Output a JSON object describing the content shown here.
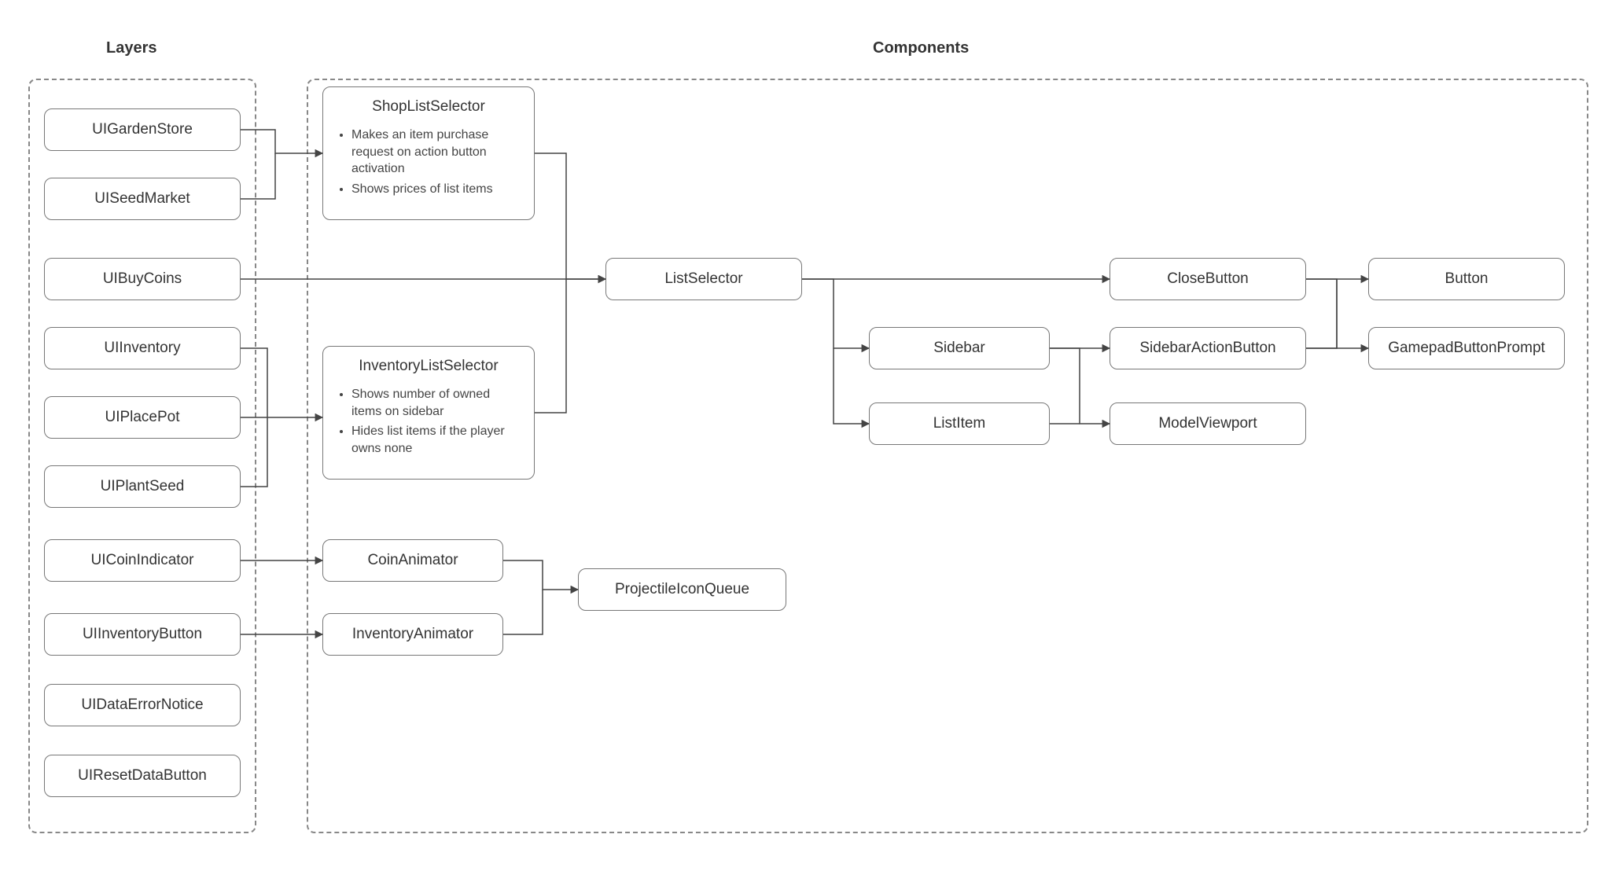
{
  "groups": {
    "layers": {
      "label": "Layers"
    },
    "components": {
      "label": "Components"
    }
  },
  "nodes": {
    "uiGardenStore": {
      "label": "UIGardenStore"
    },
    "uiSeedMarket": {
      "label": "UISeedMarket"
    },
    "uiBuyCoins": {
      "label": "UIBuyCoins"
    },
    "uiInventory": {
      "label": "UIInventory"
    },
    "uiPlacePot": {
      "label": "UIPlacePot"
    },
    "uiPlantSeed": {
      "label": "UIPlantSeed"
    },
    "uiCoinIndicator": {
      "label": "UICoinIndicator"
    },
    "uiInventoryButton": {
      "label": "UIInventoryButton"
    },
    "uiDataErrorNotice": {
      "label": "UIDataErrorNotice"
    },
    "uiResetDataButton": {
      "label": "UIResetDataButton"
    },
    "shopListSelector": {
      "label": "ShopListSelector",
      "bullets": [
        "Makes an item purchase request on action button activation",
        "Shows prices of list items"
      ]
    },
    "inventoryListSelector": {
      "label": "InventoryListSelector",
      "bullets": [
        "Shows number of owned items on sidebar",
        "Hides list items if the player owns none"
      ]
    },
    "coinAnimator": {
      "label": "CoinAnimator"
    },
    "inventoryAnimator": {
      "label": "InventoryAnimator"
    },
    "projectileIconQueue": {
      "label": "ProjectileIconQueue"
    },
    "listSelector": {
      "label": "ListSelector"
    },
    "sidebar": {
      "label": "Sidebar"
    },
    "listItem": {
      "label": "ListItem"
    },
    "closeButton": {
      "label": "CloseButton"
    },
    "sidebarActionButton": {
      "label": "SidebarActionButton"
    },
    "modelViewport": {
      "label": "ModelViewport"
    },
    "button": {
      "label": "Button"
    },
    "gamepadButtonPrompt": {
      "label": "GamepadButtonPrompt"
    }
  },
  "edges": [
    {
      "from": "uiGardenStore",
      "to": "shopListSelector"
    },
    {
      "from": "uiSeedMarket",
      "to": "shopListSelector"
    },
    {
      "from": "uiInventory",
      "to": "inventoryListSelector"
    },
    {
      "from": "uiPlacePot",
      "to": "inventoryListSelector"
    },
    {
      "from": "uiPlantSeed",
      "to": "inventoryListSelector"
    },
    {
      "from": "uiCoinIndicator",
      "to": "coinAnimator"
    },
    {
      "from": "uiInventoryButton",
      "to": "inventoryAnimator"
    },
    {
      "from": "shopListSelector",
      "to": "listSelector"
    },
    {
      "from": "uiBuyCoins",
      "to": "listSelector"
    },
    {
      "from": "inventoryListSelector",
      "to": "listSelector"
    },
    {
      "from": "coinAnimator",
      "to": "projectileIconQueue"
    },
    {
      "from": "inventoryAnimator",
      "to": "projectileIconQueue"
    },
    {
      "from": "listSelector",
      "to": "closeButton"
    },
    {
      "from": "listSelector",
      "to": "sidebar"
    },
    {
      "from": "listSelector",
      "to": "listItem"
    },
    {
      "from": "sidebar",
      "to": "sidebarActionButton"
    },
    {
      "from": "sidebar",
      "to": "modelViewport"
    },
    {
      "from": "listItem",
      "to": "modelViewport"
    },
    {
      "from": "closeButton",
      "to": "button"
    },
    {
      "from": "closeButton",
      "to": "gamepadButtonPrompt"
    },
    {
      "from": "sidebarActionButton",
      "to": "button"
    },
    {
      "from": "sidebarActionButton",
      "to": "gamepadButtonPrompt"
    }
  ]
}
